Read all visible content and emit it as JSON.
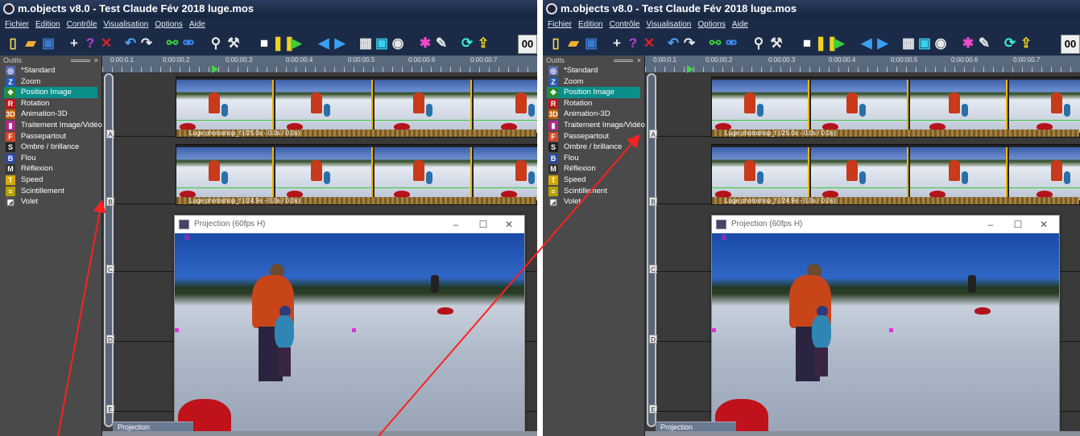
{
  "window": {
    "title": "m.objects v8.0 - Test Claude Fév 2018 luge.mos"
  },
  "menu": [
    "Fichier",
    "Edition",
    "Contrôle",
    "Visualisation",
    "Options",
    "Aide"
  ],
  "toolbar": {
    "counter_text": "00",
    "counter_x": "×"
  },
  "tools": {
    "header": "Outils",
    "close": "×",
    "items": [
      {
        "label": "*Standard",
        "icon": "standard-icon",
        "glyph": "◎",
        "color": "#5a6ab0"
      },
      {
        "label": "Zoom",
        "icon": "zoom-icon",
        "glyph": "Z",
        "color": "#2a5ab0"
      },
      {
        "label": "Position Image",
        "icon": "position-image-icon",
        "glyph": "✥",
        "color": "#2a8a2a"
      },
      {
        "label": "Rotation",
        "icon": "rotation-icon",
        "glyph": "R",
        "color": "#c01818"
      },
      {
        "label": "Animation-3D",
        "icon": "animation-3d-icon",
        "glyph": "3D",
        "color": "#c85a00"
      },
      {
        "label": "Traitement Image/Vidéo",
        "icon": "image-video-icon",
        "glyph": "▮",
        "color": "#b02a8a"
      },
      {
        "label": "Passepartout",
        "icon": "passepartout-icon",
        "glyph": "F",
        "color": "#d04a2a"
      },
      {
        "label": "Ombre / brillance",
        "icon": "shadow-icon",
        "glyph": "S",
        "color": "#222222"
      },
      {
        "label": "Flou",
        "icon": "blur-icon",
        "glyph": "B",
        "color": "#2a4aa0"
      },
      {
        "label": "Réflexion",
        "icon": "reflection-icon",
        "glyph": "M",
        "color": "#333333"
      },
      {
        "label": "Speed",
        "icon": "speed-icon",
        "glyph": "T",
        "color": "#d8a800"
      },
      {
        "label": "Scintillement",
        "icon": "sparkle-icon",
        "glyph": "≡",
        "color": "#b8a000"
      },
      {
        "label": "Volet",
        "icon": "wipe-icon",
        "glyph": "◩",
        "color": "#555555"
      }
    ]
  },
  "ruler": {
    "times": [
      "0:00:0.1",
      "0:00:00.2",
      "0:00:00.3",
      "0:00:00.4",
      "0:00:00.5",
      "0:00:00.6",
      "0:00:00.7"
    ]
  },
  "tracks": [
    "A",
    "B",
    "C",
    "D",
    "E"
  ],
  "clips": {
    "left": [
      "Luge photoshop_f (/25.0s - 0.0s / 0.0s)",
      "Luge photoshop_f (/24.9s - 0.0s / 0.0s)"
    ],
    "right": [
      "Luge photoshop_f (/25.0s - 0.0s / 0.0s)",
      "Luge photoshop_f (/24.9s - 0.0s / 0.0s)"
    ]
  },
  "projection": {
    "title": "Projection (60fps H)",
    "marker": "B",
    "minimize": "–",
    "maximize": "☐",
    "close": "✕"
  },
  "projection_tab": "Projection",
  "annotations": {
    "arrow_color": "#ff2020"
  }
}
